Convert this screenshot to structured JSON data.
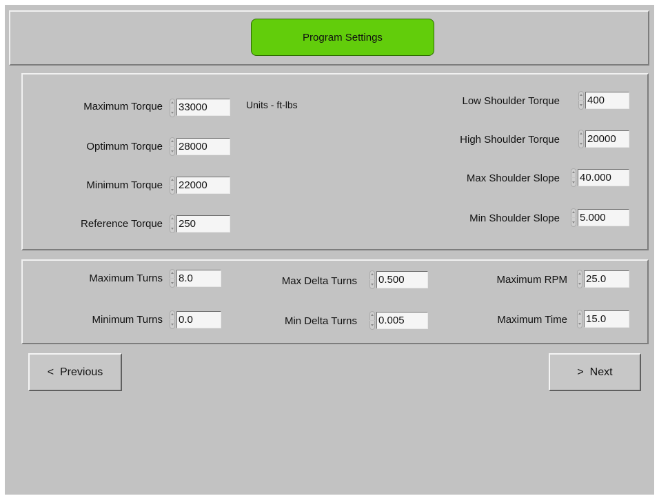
{
  "header": {
    "title": "Program Settings"
  },
  "torque": {
    "units_label": "Units - ft-lbs",
    "max": {
      "label": "Maximum Torque",
      "value": "33000"
    },
    "opt": {
      "label": "Optimum Torque",
      "value": "28000"
    },
    "min": {
      "label": "Minimum Torque",
      "value": "22000"
    },
    "ref": {
      "label": "Reference Torque",
      "value": "250"
    },
    "low_sh": {
      "label": "Low Shoulder Torque",
      "value": "400"
    },
    "high_sh": {
      "label": "High Shoulder Torque",
      "value": "20000"
    },
    "max_slope": {
      "label": "Max Shoulder Slope",
      "value": "40.000"
    },
    "min_slope": {
      "label": "Min Shoulder Slope",
      "value": "5.000"
    }
  },
  "turns": {
    "max_turns": {
      "label": "Maximum Turns",
      "value": "8.0"
    },
    "min_turns": {
      "label": "Minimum Turns",
      "value": "0.0"
    },
    "max_delta": {
      "label": "Max Delta Turns",
      "value": "0.500"
    },
    "min_delta": {
      "label": "Min Delta Turns",
      "value": "0.005"
    },
    "max_rpm": {
      "label": "Maximum RPM",
      "value": "25.0"
    },
    "max_time": {
      "label": "Maximum Time",
      "value": "15.0"
    }
  },
  "nav": {
    "previous_label": "<  Previous",
    "next_label": ">  Next"
  },
  "colors": {
    "panel": "#c2c2c2",
    "title_badge": "#62cd0b"
  }
}
